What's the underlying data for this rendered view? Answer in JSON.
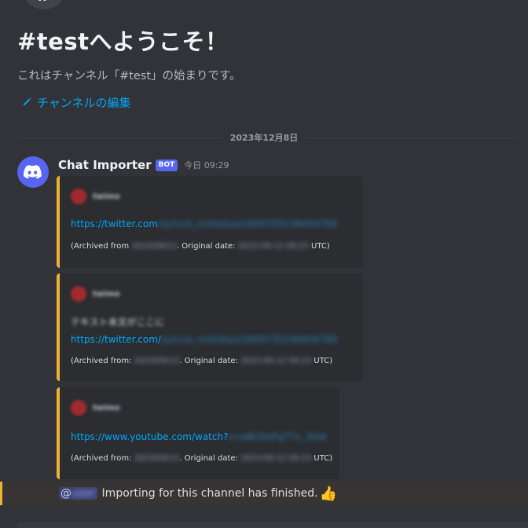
{
  "channel": {
    "icon": "hash-icon",
    "welcome_title": "#testへようこそ！",
    "welcome_subtitle": "これはチャンネル「#test」の始まりです。",
    "edit_link": "チャンネルの編集"
  },
  "divider": {
    "date": "2023年12月8日"
  },
  "message": {
    "author": "Chat Importer",
    "badge": "BOT",
    "timestamp": "今日 09:29",
    "embeds": [
      {
        "author_name": "twimo",
        "text": "",
        "link_prefix": "https://twitter.com",
        "link_hidden": "/syncro_m/status/1609735238456789",
        "archived_label": "(Archived from",
        "archived_hidden": "2023/09/12",
        "original_label": ". Original date:",
        "original_hidden": "2023-09-12 09:23",
        "utc_label": "UTC)"
      },
      {
        "author_name": "twimo",
        "text": "テキスト本文がここに",
        "link_prefix": "https://twitter.com/",
        "link_hidden": "syncro_m/status/1609735238456789",
        "archived_label": "(Archived from:",
        "archived_hidden": "2023/09/12",
        "original_label": ". Original date:",
        "original_hidden": "2023-09-12 09:23",
        "utc_label": "UTC)"
      },
      {
        "author_name": "twimo",
        "text": "",
        "link_prefix": "https://www.youtube.com/watch?",
        "link_hidden": "v=aBcDeFg7Tx_3Qw",
        "archived_label": "(Archived from:",
        "archived_hidden": "2023/09/12",
        "original_label": ". Original date:",
        "original_hidden": "2023-09-12 09:23",
        "utc_label": "UTC)"
      }
    ]
  },
  "system": {
    "mention_prefix": "@",
    "mention_hidden": "user",
    "text": "Importing for this channel has finished.",
    "emoji": "👍"
  },
  "colors": {
    "accent": "#5865f2",
    "embed_border": "#f0b232",
    "link": "#00a8fc"
  }
}
